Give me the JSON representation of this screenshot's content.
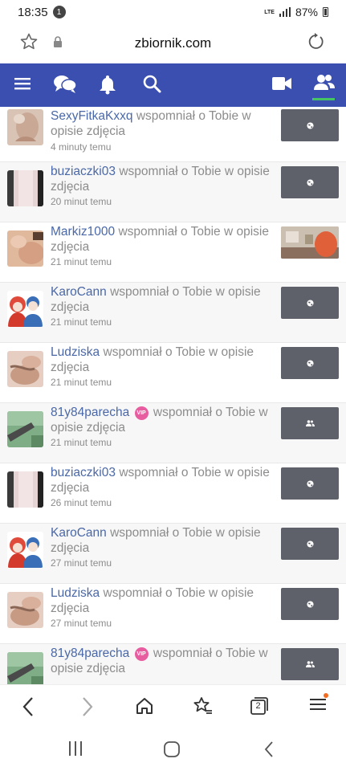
{
  "status_bar": {
    "time": "18:35",
    "notification_count": "1",
    "network": "LTE",
    "battery": "87%"
  },
  "url_bar": {
    "domain": "zbiornik.com"
  },
  "nav": {
    "accent_color": "#3a4fb0",
    "active_indicator_color": "#44c462"
  },
  "notifications": [
    {
      "user": "SexyFitkaKxxq",
      "vip": false,
      "message": "wspomniał o Tobie w opisie zdjęcia",
      "time": "4 minuty temu",
      "thumb": "globe-icon"
    },
    {
      "user": "buziaczki03",
      "vip": false,
      "message": "wspomniał o Tobie w opisie zdjęcia",
      "time": "20 minut temu",
      "thumb": "globe-icon"
    },
    {
      "user": "Markiz1000",
      "vip": false,
      "message": "wspomniał o Tobie w opisie zdjęcia",
      "time": "21 minut temu",
      "thumb": "photo"
    },
    {
      "user": "KaroCann",
      "vip": false,
      "message": "wspomniał o Tobie w opisie zdjęcia",
      "time": "21 minut temu",
      "thumb": "globe-icon"
    },
    {
      "user": "Ludziska",
      "vip": false,
      "message": "wspomniał o Tobie w opisie zdjęcia",
      "time": "21 minut temu",
      "thumb": "globe-icon"
    },
    {
      "user": "81y84parecha",
      "vip": true,
      "vip_label": "VIP",
      "message": "wspomniał o Tobie w opisie zdjęcia",
      "time": "21 minut temu",
      "thumb": "friends-icon"
    },
    {
      "user": "buziaczki03",
      "vip": false,
      "message": "wspomniał o Tobie w opisie zdjęcia",
      "time": "26 minut temu",
      "thumb": "globe-icon"
    },
    {
      "user": "KaroCann",
      "vip": false,
      "message": "wspomniał o Tobie w opisie zdjęcia",
      "time": "27 minut temu",
      "thumb": "globe-icon"
    },
    {
      "user": "Ludziska",
      "vip": false,
      "message": "wspomniał o Tobie w opisie zdjęcia",
      "time": "27 minut temu",
      "thumb": "globe-icon"
    },
    {
      "user": "81y84parecha",
      "vip": true,
      "vip_label": "VIP",
      "message": "wspomniał o Tobie w opisie zdjęcia",
      "time": "",
      "thumb": "friends-icon"
    }
  ],
  "bottom_bar": {
    "tabs_count": "2"
  }
}
